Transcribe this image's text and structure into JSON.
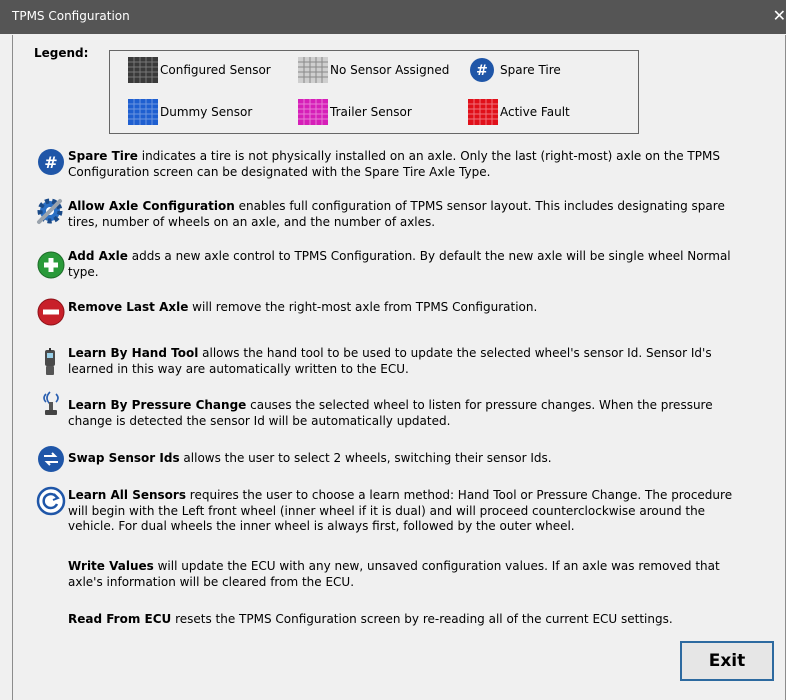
{
  "window": {
    "title": "TPMS Configuration",
    "close_glyph": "✕"
  },
  "legend": {
    "label": "Legend:",
    "items": [
      {
        "label": "Configured Sensor",
        "icon": "configured-sensor-tile",
        "color": "#3a3a3a"
      },
      {
        "label": "No Sensor Assigned",
        "icon": "no-sensor-tile",
        "color": "#cfcfcf"
      },
      {
        "label": "Spare Tire",
        "icon": "spare-tire-icon",
        "color": "#1f56a8"
      },
      {
        "label": "Dummy Sensor",
        "icon": "dummy-sensor-tile",
        "color": "#1f5fd0"
      },
      {
        "label": "Trailer Sensor",
        "icon": "trailer-sensor-tile",
        "color": "#d61fb8"
      },
      {
        "label": "Active Fault",
        "icon": "active-fault-tile",
        "color": "#e0101a"
      }
    ]
  },
  "help": [
    {
      "title": "Spare Tire",
      "text": " indicates a tire is not physically installed on an axle. Only the last (right-most) axle on the TPMS Configuration screen can be designated with the Spare Tire Axle Type.",
      "icon": "spare-tire-icon"
    },
    {
      "title": "Allow Axle Configuration",
      "text": " enables full configuration of TPMS sensor layout. This includes designating spare tires, number of wheels on an axle, and the number of axles.",
      "icon": "gear-wrench-icon"
    },
    {
      "title": "Add Axle",
      "text": " adds a new axle control to TPMS Configuration. By default the new axle will be single wheel Normal type.",
      "icon": "add-icon"
    },
    {
      "title": "Remove Last Axle",
      "text": " will remove the right-most axle from TPMS Configuration.",
      "icon": "remove-icon"
    },
    {
      "title": "Learn By Hand Tool",
      "text": " allows the hand tool to be used to update the selected wheel's sensor Id. Sensor Id's learned in this way are automatically written to the ECU.",
      "icon": "hand-tool-icon"
    },
    {
      "title": "Learn By Pressure Change",
      "text": " causes the selected wheel to listen for pressure changes. When the pressure change is detected the sensor Id will be automatically updated.",
      "icon": "pressure-valve-icon"
    },
    {
      "title": "Swap Sensor Ids",
      "text": " allows the user to select 2 wheels, switching their sensor Ids.",
      "icon": "swap-icon"
    },
    {
      "title": "Learn All Sensors",
      "text": " requires the user to choose a learn method: Hand Tool or Pressure Change. The procedure will begin with the Left front wheel (inner wheel if it is dual) and will proceed counterclockwise around the vehicle. For dual wheels the inner wheel is always first, followed by the outer wheel.",
      "icon": "refresh-icon"
    },
    {
      "title": "Write Values",
      "text": " will update the ECU with any new, unsaved configuration values. If an axle was removed that axle's information will be cleared from the ECU."
    },
    {
      "title": "Read From ECU",
      "text": " resets the TPMS Configuration screen by re-reading all of the current ECU settings."
    }
  ],
  "exit_label": "Exit"
}
